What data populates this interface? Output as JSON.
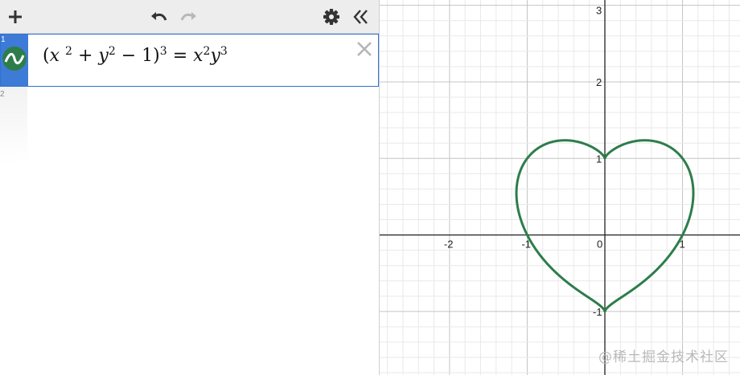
{
  "toolbar": {
    "add_icon": "plus-icon",
    "undo_icon": "undo-icon",
    "redo_icon": "redo-icon",
    "settings_icon": "gear-icon",
    "collapse_icon": "double-chevron-left-icon"
  },
  "expressions": [
    {
      "index": "1",
      "icon": "curve-wave-icon",
      "color": "#2d7d4b",
      "latex_parts": {
        "open": "(",
        "x": "x",
        "x_exp": "2",
        "plus": "+",
        "y": "y",
        "y_exp": "2",
        "minus": "− 1",
        "close": ")",
        "outer_exp": "3",
        "equals": "=",
        "rx": "x",
        "rx_exp": "2",
        "ry": "y",
        "ry_exp": "3"
      }
    },
    {
      "index": "2"
    }
  ],
  "graph": {
    "x_ticks": [
      "-2",
      "-1",
      "0",
      "1"
    ],
    "y_ticks": [
      "3",
      "2",
      "1",
      "-1"
    ],
    "xlim": [
      -2.9,
      1.74
    ],
    "ylim": [
      -1.83,
      3.07
    ],
    "curve_color": "#2d7d4b",
    "grid": true
  },
  "watermark": "@稀土掘金技术社区"
}
